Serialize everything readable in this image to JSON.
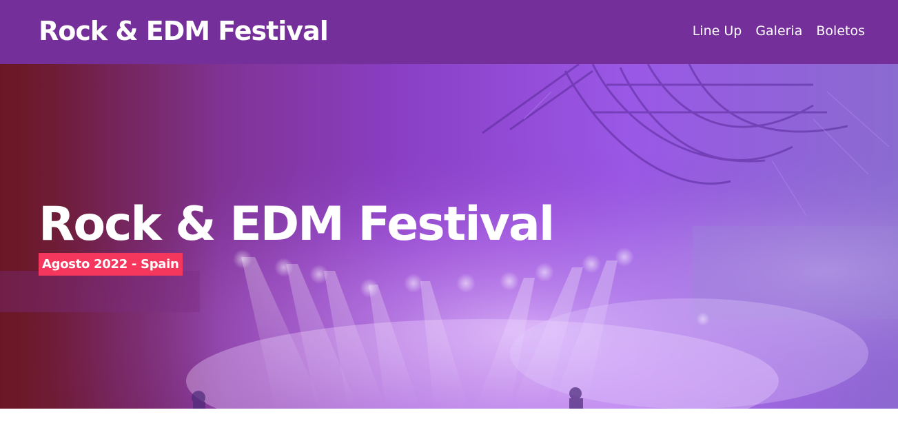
{
  "header": {
    "logo": "Rock & EDM Festival",
    "nav": {
      "lineup": "Line Up",
      "gallery": "Galeria",
      "tickets": "Boletos"
    }
  },
  "hero": {
    "title": "Rock & EDM Festival",
    "subtitle": "Agosto 2022 - Spain"
  },
  "colors": {
    "header_bg": "#752f9a",
    "badge_bg": "#f6375d",
    "text": "#ffffff"
  }
}
